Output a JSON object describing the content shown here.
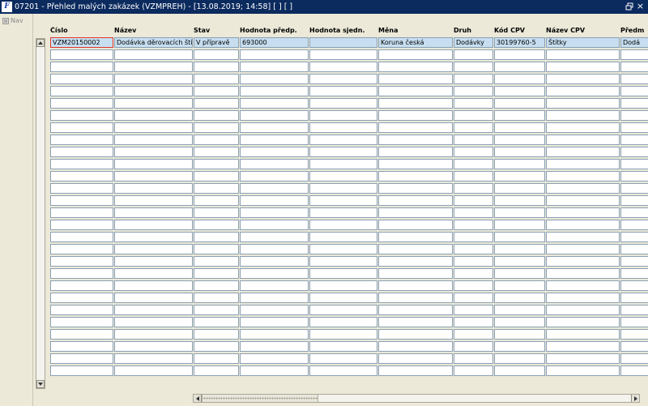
{
  "window": {
    "app_icon_text": "F",
    "title": "07201 - Přehled malých zakázek (VZMPREH) - [13.08.2019; 14:58]  [ ]  [ ]",
    "close_glyph": "×"
  },
  "nav": {
    "label": "Nav"
  },
  "table": {
    "columns": [
      "Číslo",
      "Název",
      "Stav",
      "Hodnota předp.",
      "Hodnota sjedn.",
      "Měna",
      "Druh",
      "Kód CPV",
      "Název CPV",
      "Předm"
    ],
    "rows": [
      [
        "VZM20150002",
        "Dodávka děrovacích štítků",
        "V přípravě",
        "693000",
        "",
        "Koruna česká",
        "Dodávky",
        "30199760-5",
        "Štítky",
        "Dodá"
      ]
    ],
    "total_visible_rows": 28
  },
  "colors": {
    "titlebar": "#0b2a5e",
    "selected_row": "#c6def0",
    "active_cell_border": "#e0352b",
    "cell_border": "#8aa0b4"
  }
}
